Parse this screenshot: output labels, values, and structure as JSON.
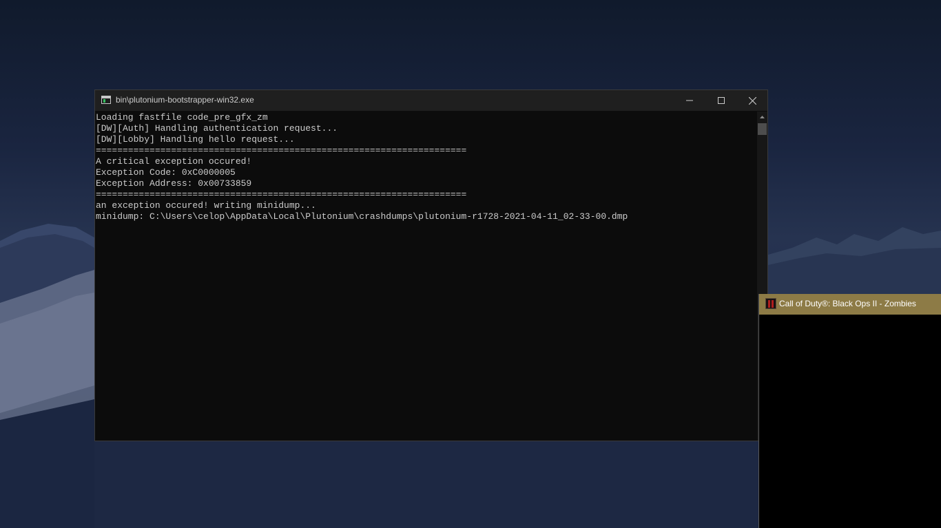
{
  "console_window": {
    "title": "bin\\plutonium-bootstrapper-win32.exe",
    "icon": "console-app-icon",
    "caption_buttons": [
      "minimize-icon",
      "maximize-icon",
      "close-icon"
    ],
    "lines": [
      "Loading fastfile code_pre_gfx_zm",
      "[DW][Auth] Handling authentication request...",
      "[DW][Lobby] Handling hello request...",
      "=====================================================================",
      "A critical exception occured!",
      "Exception Code: 0xC0000005",
      "Exception Address: 0x00733859",
      "=====================================================================",
      "an exception occured! writing minidump...",
      "minidump: C:\\Users\\celop\\AppData\\Local\\Plutonium\\crashdumps\\plutonium-r1728-2021-04-11_02-33-00.dmp"
    ],
    "text_color": "#cccccc",
    "background_color": "#0c0c0c"
  },
  "game_window": {
    "title": "Call of Duty®: Black Ops II - Zombies",
    "icon": "game-app-icon",
    "titlebar_color": "#8d7b46"
  }
}
